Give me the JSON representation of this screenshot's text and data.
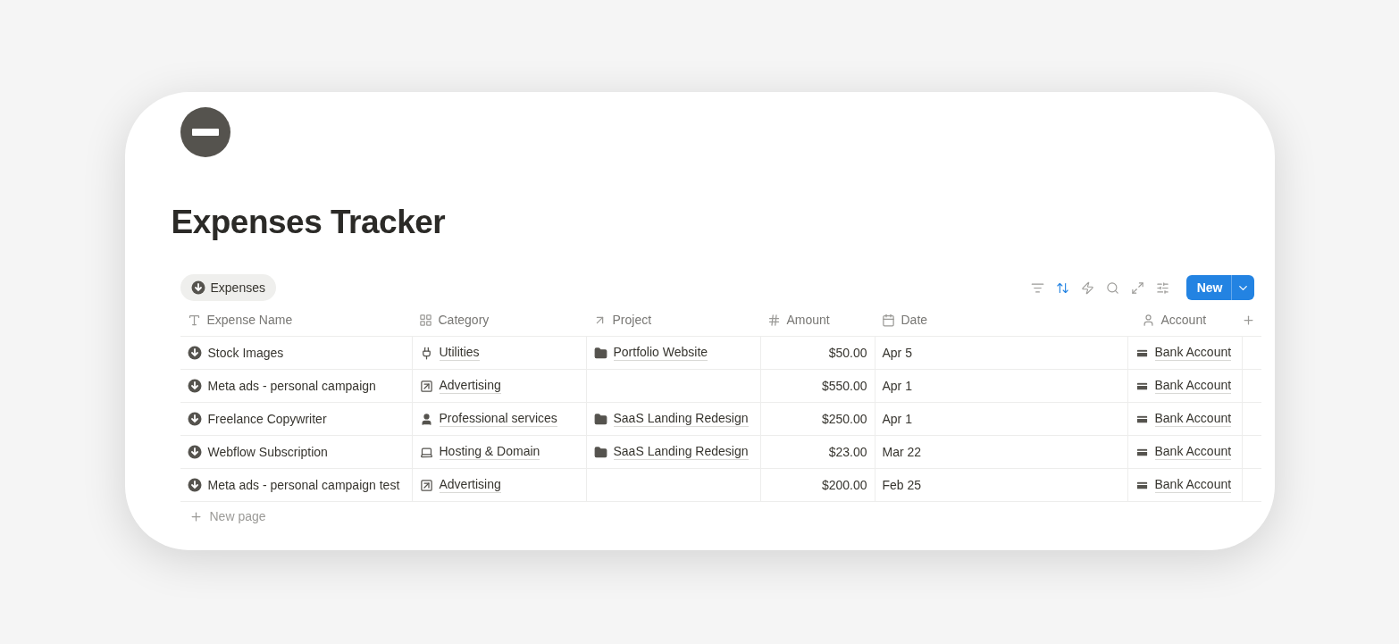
{
  "page": {
    "title": "Expenses Tracker"
  },
  "view_tab": {
    "label": "Expenses",
    "selected": true
  },
  "toolbar": [
    {
      "kind": "filter",
      "active": false
    },
    {
      "kind": "sort",
      "active": true
    },
    {
      "kind": "automation",
      "active": false
    },
    {
      "kind": "search",
      "active": false
    },
    {
      "kind": "expand",
      "active": false
    },
    {
      "kind": "settings",
      "active": false
    }
  ],
  "new_button": {
    "label": "New"
  },
  "table": {
    "columns": [
      {
        "kind": "title",
        "label": "Expense Name"
      },
      {
        "kind": "select",
        "label": "Category"
      },
      {
        "kind": "relation",
        "label": "Project"
      },
      {
        "kind": "number",
        "label": "Amount"
      },
      {
        "kind": "date",
        "label": "Date"
      },
      {
        "kind": "person",
        "label": "Account"
      }
    ],
    "rows": [
      {
        "name": "Stock Images",
        "category": {
          "label": "Utilities",
          "kind": "plug"
        },
        "project": "Portfolio Website",
        "amount": "$50.00",
        "date": "Apr 5",
        "account": "Bank Account"
      },
      {
        "name": "Meta ads - personal campaign",
        "category": {
          "label": "Advertising",
          "kind": "ad"
        },
        "amount": "$550.00",
        "date": "Apr 1",
        "account": "Bank Account"
      },
      {
        "name": "Freelance Copywriter",
        "category": {
          "label": "Professional services",
          "kind": "person"
        },
        "project": "SaaS Landing Redesign",
        "amount": "$250.00",
        "date": "Apr 1",
        "account": "Bank Account"
      },
      {
        "name": "Webflow Subscription",
        "category": {
          "label": "Hosting & Domain",
          "kind": "laptop"
        },
        "project": "SaaS Landing Redesign",
        "amount": "$23.00",
        "date": "Mar 22",
        "account": "Bank Account"
      },
      {
        "name": "Meta ads - personal campaign test",
        "category": {
          "label": "Advertising",
          "kind": "ad"
        },
        "amount": "$200.00",
        "date": "Feb 25",
        "account": "Bank Account"
      }
    ],
    "new_row": "New page"
  }
}
